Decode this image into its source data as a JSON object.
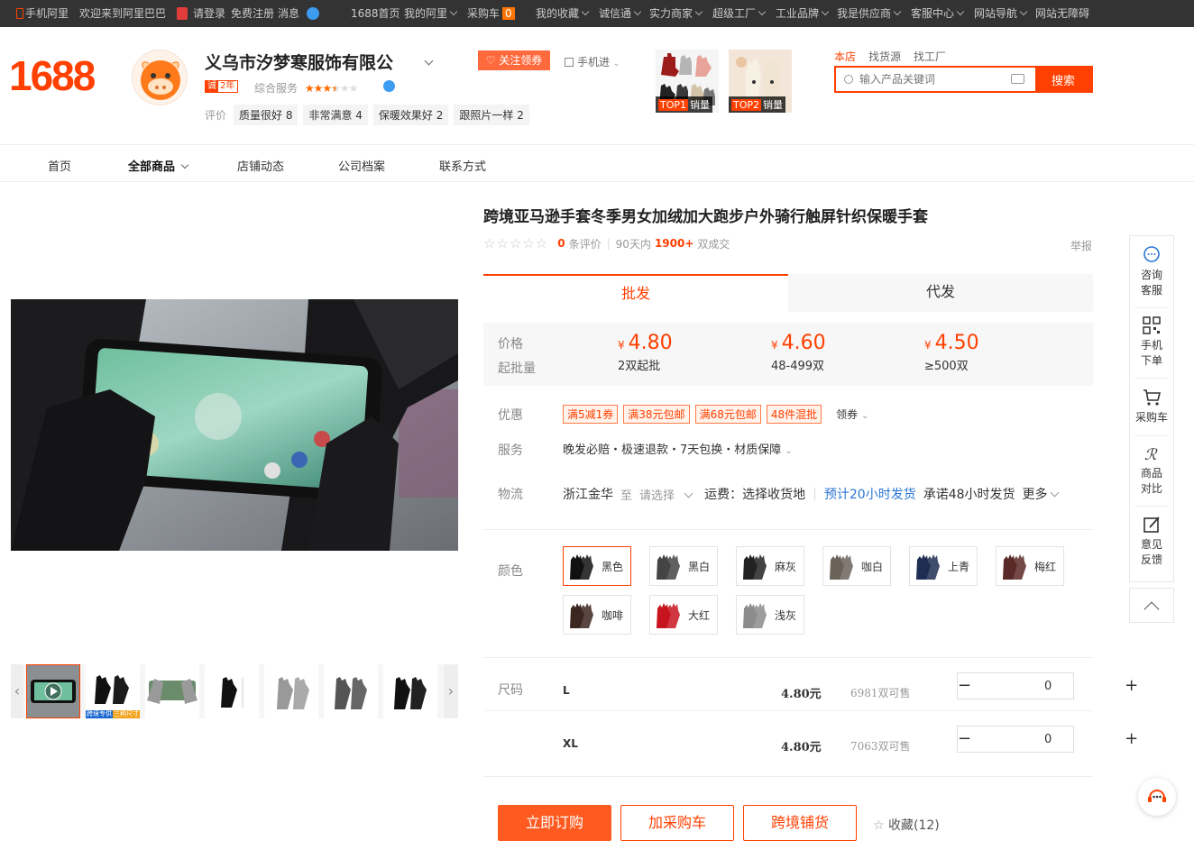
{
  "topbar": {
    "mobile_ali": "手机阿里",
    "welcome": "欢迎来到阿里巴巴",
    "login": "请登录",
    "register": "免费注册",
    "messages": "消息",
    "home": "1688首页",
    "my_ali": "我的阿里",
    "cart": "采购车",
    "cart_count": "0",
    "favorites": "我的收藏",
    "trust": "诚信通",
    "power_merchant": "实力商家",
    "super_factory": "超级工厂",
    "industrial_brand": "工业品牌",
    "i_am_supplier": "我是供应商",
    "service_center": "客服中心",
    "site_nav": "网站导航",
    "accessible": "网站无障碍"
  },
  "header": {
    "logo": "1688",
    "shop_name": "义乌市汐梦寒服饰有限公",
    "years_tag": "诚",
    "years": "2年",
    "service_label": "综合服务",
    "service_stars": 3.5,
    "reviews_label": "评价",
    "review_tags": [
      "质量很好 8",
      "非常满意 4",
      "保暖效果好 2",
      "跟照片一样 2"
    ],
    "follow_btn": "关注领券",
    "mobile_btn": "手机进",
    "top1": {
      "rank": "TOP1",
      "label": "销量"
    },
    "top2": {
      "rank": "TOP2",
      "label": "销量"
    }
  },
  "search": {
    "tabs": [
      "本店",
      "找货源",
      "找工厂"
    ],
    "placeholder": "输入产品关键词",
    "button": "搜索"
  },
  "nav": [
    "首页",
    "全部商品",
    "店铺动态",
    "公司档案",
    "联系方式"
  ],
  "product": {
    "title": "跨境亚马逊手套冬季男女加绒加大跑步户外骑行触屏针织保暖手套",
    "review_count": "0",
    "review_label": "条评价",
    "sales_period": "90天内",
    "sales_count": "1900+",
    "sales_label": "双成交",
    "report": "举报",
    "tab_wholesale": "批发",
    "tab_dropship": "代发",
    "price_label": "价格",
    "moq_label": "起批量",
    "currency": "¥",
    "tiers": [
      {
        "price": "4.80",
        "qty": "2双起批"
      },
      {
        "price": "4.60",
        "qty": "48-499双"
      },
      {
        "price": "4.50",
        "qty": "≥500双"
      }
    ],
    "discount_label": "优惠",
    "coupons": [
      "满5减1券",
      "满38元包邮",
      "满68元包邮",
      "48件混批"
    ],
    "get_coupon": "领券",
    "service_label": "服务",
    "services": "晚发必赔・极速退款・7天包换・材质保障",
    "logistics_label": "物流",
    "origin": "浙江金华",
    "to": "至",
    "choose": "请选择",
    "freight": "运费：选择收货地",
    "eta": "预计20小时发货",
    "promise": "承诺48小时发货",
    "more": "更多",
    "color_label": "颜色",
    "colors": [
      {
        "name": "黑色",
        "color": "#111111"
      },
      {
        "name": "黑白",
        "color": "#444444"
      },
      {
        "name": "麻灰",
        "color": "#222222"
      },
      {
        "name": "咖白",
        "color": "#6b625a"
      },
      {
        "name": "上青",
        "color": "#1f2d52"
      },
      {
        "name": "梅红",
        "color": "#5a2a28"
      },
      {
        "name": "咖啡",
        "color": "#3c2620"
      },
      {
        "name": "大红",
        "color": "#c8141e"
      },
      {
        "name": "浅灰",
        "color": "#8c8c8c"
      }
    ],
    "size_label": "尺码",
    "sizes": [
      {
        "name": "L",
        "price": "4.80元",
        "stock": "6981双可售",
        "qty": "0"
      },
      {
        "name": "XL",
        "price": "4.80元",
        "stock": "7063双可售",
        "qty": "0"
      }
    ],
    "buy_now": "立即订购",
    "add_cart": "加采购车",
    "cross_border": "跨境铺货",
    "favorite": "收藏(12)",
    "thumb_badge_left": "跨境专供",
    "thumb_badge_right": "三种尺寸"
  },
  "sidebar": [
    {
      "l1": "咨询",
      "l2": "客服",
      "icon": "chat-icon"
    },
    {
      "l1": "手机",
      "l2": "下单",
      "icon": "qrcode-icon"
    },
    {
      "l1": "采购车",
      "l2": "",
      "icon": "cart-icon"
    },
    {
      "l1": "商品",
      "l2": "对比",
      "icon": "compare-icon"
    },
    {
      "l1": "意见",
      "l2": "反馈",
      "icon": "feedback-icon"
    }
  ],
  "colors": {
    "brand": "#ff4000",
    "accent": "#ff5a1f",
    "link": "#2b75d4"
  }
}
